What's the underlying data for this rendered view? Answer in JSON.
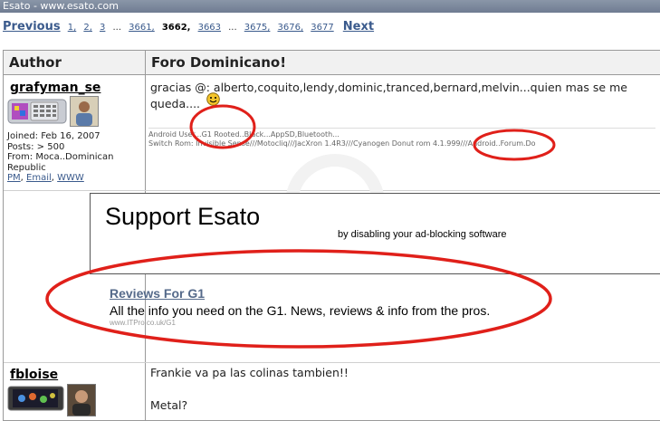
{
  "window": {
    "title": "Esato - www.esato.com"
  },
  "pager": {
    "previous": "Previous",
    "pages_start": [
      "1,",
      "2,",
      "3"
    ],
    "ellipsis1": "...",
    "p3661": "3661,",
    "p3662": "3662,",
    "p3663": "3663",
    "ellipsis2": "...",
    "pages_end": [
      "3675,",
      "3676,",
      "3677"
    ],
    "next": "Next"
  },
  "table": {
    "header_author": "Author",
    "header_topic": "Foro Dominicano!"
  },
  "posts": [
    {
      "author": "grafyman_se",
      "joined": "Joined: Feb 16, 2007",
      "posts": "Posts: > 500",
      "from_line1": "From: Moca..Dominican",
      "from_line2": "Republic",
      "links": [
        "PM",
        "Email",
        "WWW"
      ],
      "body_line1": "gracias @: alberto,coquito,lendy,dominic,tranced,bernard,melvin...quien mas se me",
      "body_line2": "queda....",
      "sig_line1": "Android User...G1 Rooted..Black...AppSD,Bluetooth...",
      "sig_line2": "Switch Rom: Invisible Sense///Motocliq///JacXron 1.4R3///Cyanogen Donut rom 4.1.999///Android..Forum.Do"
    },
    {
      "author": "fbloise",
      "body_line1": "Frankie va pa las colinas tambien!!",
      "body_line2": "Metal?"
    }
  ],
  "ad": {
    "title": "Support Esato",
    "subtitle": "by disabling your ad-blocking software",
    "link": "Reviews For G1",
    "text": "All the info you need on the G1. News, reviews & info from the pros.",
    "url": "www.ITPro.co.uk/G1"
  },
  "colors": {
    "annotation": "#e0201a",
    "link": "#3a5a8c",
    "titlebar": "#7a879b"
  }
}
